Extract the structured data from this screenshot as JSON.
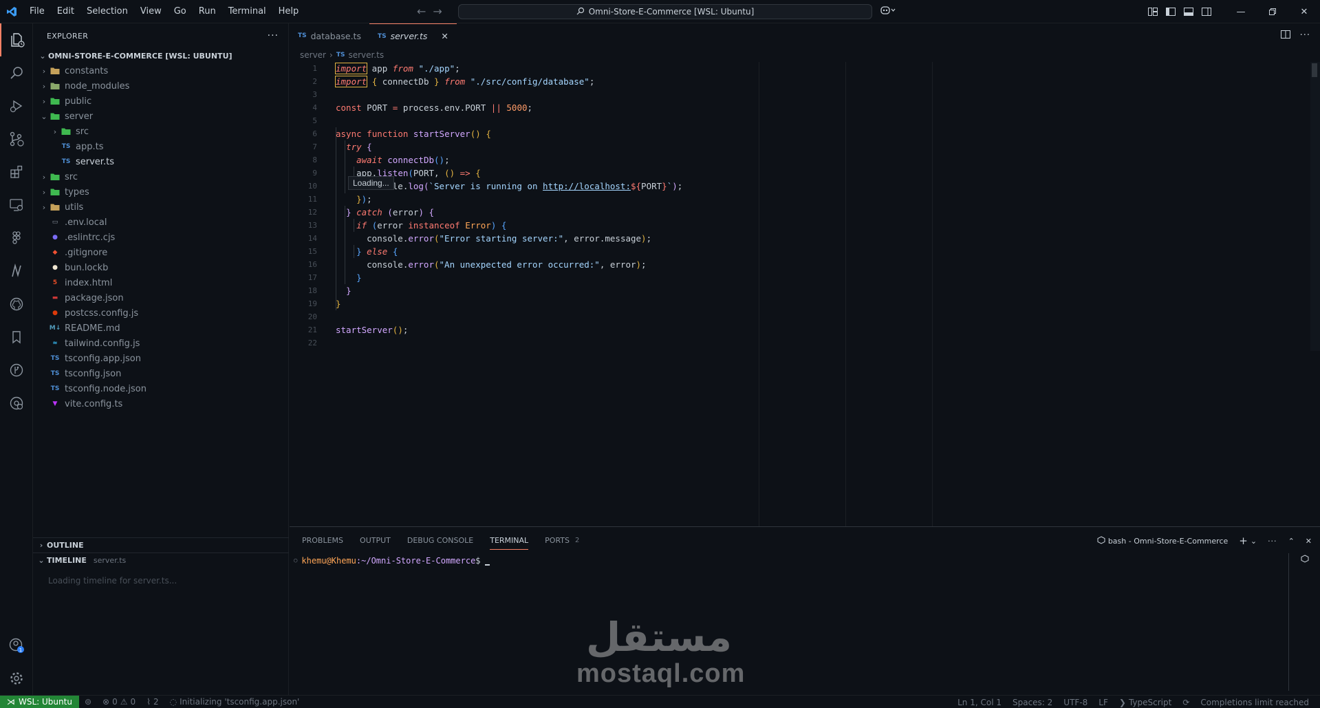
{
  "menu": [
    "File",
    "Edit",
    "Selection",
    "View",
    "Go",
    "Run",
    "Terminal",
    "Help"
  ],
  "command_center": "Omni-Store-E-Commerce [WSL: Ubuntu]",
  "explorer": {
    "title": "EXPLORER",
    "root": "OMNI-STORE-E-COMMERCE [WSL: UBUNTU]",
    "items": [
      {
        "label": "constants",
        "type": "folder",
        "depth": 0,
        "expanded": false,
        "color": "#c5a15a"
      },
      {
        "label": "node_modules",
        "type": "folder",
        "depth": 0,
        "expanded": false,
        "color": "#8aa96b"
      },
      {
        "label": "public",
        "type": "folder",
        "depth": 0,
        "expanded": false,
        "color": "#3fb950"
      },
      {
        "label": "server",
        "type": "folder",
        "depth": 0,
        "expanded": true,
        "color": "#3fb950"
      },
      {
        "label": "src",
        "type": "folder",
        "depth": 1,
        "expanded": false,
        "color": "#3fb950"
      },
      {
        "label": "app.ts",
        "type": "ts",
        "depth": 1
      },
      {
        "label": "server.ts",
        "type": "ts",
        "depth": 1,
        "selected": true
      },
      {
        "label": "src",
        "type": "folder",
        "depth": 0,
        "expanded": false,
        "color": "#3fb950"
      },
      {
        "label": "types",
        "type": "folder",
        "depth": 0,
        "expanded": false,
        "color": "#3fb950"
      },
      {
        "label": "utils",
        "type": "folder",
        "depth": 0,
        "expanded": false,
        "color": "#c5a15a"
      },
      {
        "label": ".env.local",
        "type": "env",
        "depth": 0
      },
      {
        "label": ".eslintrc.cjs",
        "type": "eslint",
        "depth": 0
      },
      {
        "label": ".gitignore",
        "type": "git",
        "depth": 0
      },
      {
        "label": "bun.lockb",
        "type": "bun",
        "depth": 0
      },
      {
        "label": "index.html",
        "type": "html",
        "depth": 0
      },
      {
        "label": "package.json",
        "type": "npm",
        "depth": 0
      },
      {
        "label": "postcss.config.js",
        "type": "postcss",
        "depth": 0
      },
      {
        "label": "README.md",
        "type": "md",
        "depth": 0
      },
      {
        "label": "tailwind.config.js",
        "type": "tailwind",
        "depth": 0
      },
      {
        "label": "tsconfig.app.json",
        "type": "tsconfig",
        "depth": 0
      },
      {
        "label": "tsconfig.json",
        "type": "tsconfig",
        "depth": 0
      },
      {
        "label": "tsconfig.node.json",
        "type": "tsconfig",
        "depth": 0
      },
      {
        "label": "vite.config.ts",
        "type": "vite",
        "depth": 0
      }
    ],
    "outline": "OUTLINE",
    "timeline": "TIMELINE",
    "timeline_file": "server.ts",
    "timeline_loading": "Loading timeline for server.ts..."
  },
  "tabs": [
    {
      "label": "database.ts",
      "active": false
    },
    {
      "label": "server.ts",
      "active": true
    }
  ],
  "breadcrumb": {
    "folder": "server",
    "file": "server.ts"
  },
  "loading_tooltip": "Loading...",
  "panel": {
    "tabs": [
      "PROBLEMS",
      "OUTPUT",
      "DEBUG CONSOLE",
      "TERMINAL",
      "PORTS"
    ],
    "active": "TERMINAL",
    "ports_count": "2",
    "terminal_name": "bash - Omni-Store-E-Commerce",
    "prompt_user": "khemu@Khemu",
    "prompt_path": ":~/Omni-Store-E-Commerce",
    "prompt_symbol": "$"
  },
  "watermark": {
    "arabic": "مستقل",
    "latin": "mostaql.com"
  },
  "statusbar": {
    "remote": "WSL: Ubuntu",
    "errors": "0",
    "warnings": "0",
    "ports": "2",
    "initializing": "Initializing 'tsconfig.app.json'",
    "position": "Ln 1, Col 1",
    "spaces": "Spaces: 2",
    "encoding": "UTF-8",
    "eol": "LF",
    "language": "TypeScript",
    "completions": "Completions limit reached"
  }
}
